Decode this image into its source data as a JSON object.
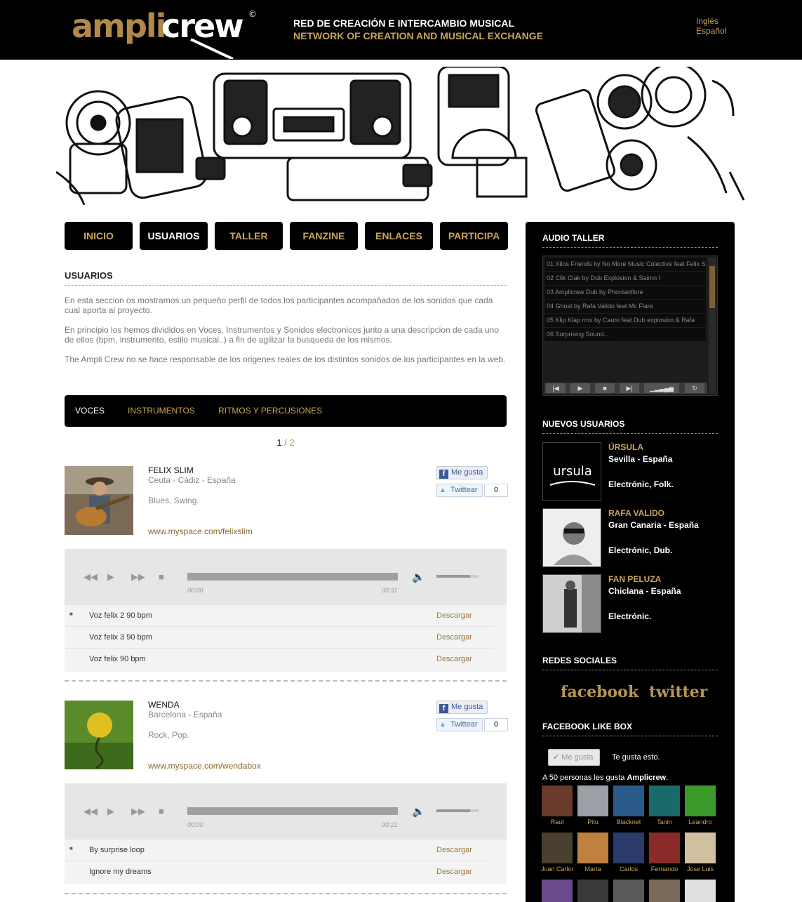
{
  "header": {
    "logo_text": "amplicrew",
    "logo_symbol": "©",
    "tagline_es": "RED DE CREACIÓN E INTERCAMBIO MUSICAL",
    "tagline_en": "NETWORK OF CREATION AND MUSICAL EXCHANGE",
    "languages": [
      "Inglés",
      "Español"
    ]
  },
  "nav": {
    "items": [
      "INICIO",
      "USUARIOS",
      "TALLER",
      "FANZINE",
      "ENLACES",
      "PARTICIPA"
    ],
    "active": "USUARIOS"
  },
  "main": {
    "section_title": "USUARIOS",
    "paragraphs": [
      "En esta seccion os mostramos un pequeño perfil de todos los participantes acompañados de los sonidos que cada cual aporta al proyecto.",
      "En principio los hemos divididos en Voces, Instrumentos y Sonidos electronicos junto a una descripcion de cada uno de ellos (bpm, instrumento, estilo musical..) a fin de agilizar la busqueda de los mismos.",
      "The Ampli Crew no se hace responsable de los origenes reales de los distintos sonidos de los participantes en la web."
    ],
    "subtabs": [
      "VOCES",
      "INSTRUMENTOS",
      "RITMOS Y PERCUSIONES"
    ],
    "active_subtab": "VOCES",
    "pager": {
      "current": "1",
      "separator": "/",
      "next": "2"
    },
    "fb_like_label": "Me gusta",
    "tweet_label": "Twittear",
    "download_label": "Descargar",
    "users": [
      {
        "name": "FELIX SLIM",
        "location": "Ceuta - Cádiz - España",
        "styles": "Blues, Swing.",
        "link": "www.myspace.com/felixslim",
        "tweet_count": "0",
        "time_start": "00:00",
        "time_end": "00:31",
        "tracks": [
          "Voz felix 2 90 bpm",
          "Voz felix 3 90 bpm",
          "Voz felix 90 bpm"
        ]
      },
      {
        "name": "WENDA",
        "location": "Barcelona - España",
        "styles": "Rock, Pop.",
        "link": "www.myspace.com/wendabox",
        "tweet_count": "0",
        "time_start": "00:00",
        "time_end": "00:21",
        "tracks": [
          "By surprise loop",
          "Ignore my dreams"
        ]
      }
    ]
  },
  "sidebar": {
    "audio_title": "AUDIO TALLER",
    "audio_tracks": [
      "01 Xilos Friends by No More Music Colective feat Felix Sli",
      "02 Clik Clak by Dub Explosion & Saimn I",
      "03 Amplicrew Dub by Phonianflore",
      "04 Ghost by Rafa Valido feat Mc Flare",
      "05  Klip Klap rmx by Cauto feat Dub explosion & Rafa",
      "06  Surprising Sound..."
    ],
    "new_users_title": "NUEVOS USUARIOS",
    "new_users": [
      {
        "name": "ÚRSULA",
        "location": "Sevilla - España",
        "styles": "Electrónic, Folk.",
        "pic_text": "ursula"
      },
      {
        "name": "RAFA VALIDO",
        "location": "Gran Canaria - España",
        "styles": "Electrónic, Dub."
      },
      {
        "name": "FAN PELUZA",
        "location": "Chiclana - España",
        "styles": "Electrónic."
      }
    ],
    "social_title": "REDES SOCIALES",
    "social_links": [
      "facebook",
      "twitter"
    ],
    "likebox_title": "FACEBOOK LIKE BOX",
    "likebox_button": "Me gusta",
    "likebox_text": "Te gusta esto.",
    "likebox_count_prefix": "A 50 personas les gusta",
    "likebox_page": "Amplicrew",
    "fans": [
      "Raul",
      "Pitu",
      "Blacknet",
      "Tanin",
      "Leandro",
      "Juan Carlos",
      "Marta",
      "Carlos",
      "Fernando",
      "Jose Luis"
    ]
  },
  "colors": {
    "accent": "#c9a45a",
    "background": "#000000",
    "link": "#8a6a2a"
  }
}
